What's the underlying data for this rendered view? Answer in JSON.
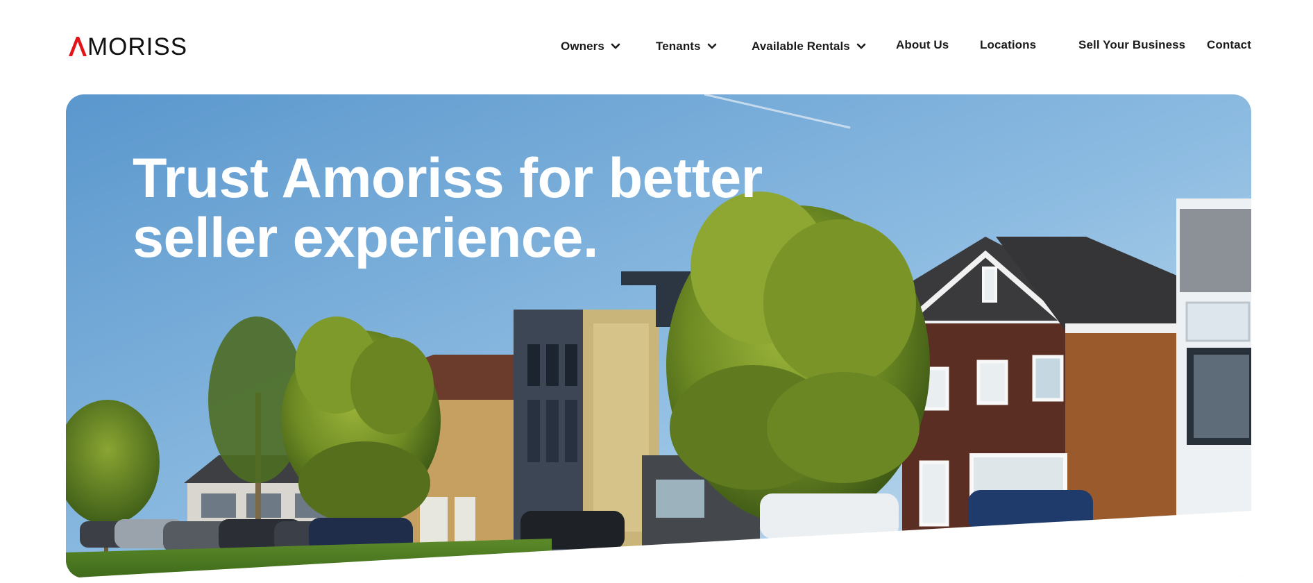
{
  "brand": {
    "name": "MORISS",
    "logo_mark_color": "#e3151b"
  },
  "nav": {
    "items": [
      {
        "label": "Owners",
        "has_dropdown": true
      },
      {
        "label": "Tenants",
        "has_dropdown": true
      },
      {
        "label": "Available Rentals",
        "has_dropdown": true
      },
      {
        "label": "About Us",
        "has_dropdown": false
      },
      {
        "label": "Locations",
        "has_dropdown": false
      },
      {
        "label": "Sell Your Business",
        "has_dropdown": false
      },
      {
        "label": "Contact",
        "has_dropdown": false
      }
    ],
    "dropdown_icon": "chevron-down-icon"
  },
  "hero": {
    "title_line1": "Trust Amoriss for better",
    "title_line2": "seller experience.",
    "image_description_icon": "residential-street-photo"
  },
  "colors": {
    "text": "#1b1b1b",
    "hero_text": "#ffffff",
    "accent": "#e3151b"
  }
}
